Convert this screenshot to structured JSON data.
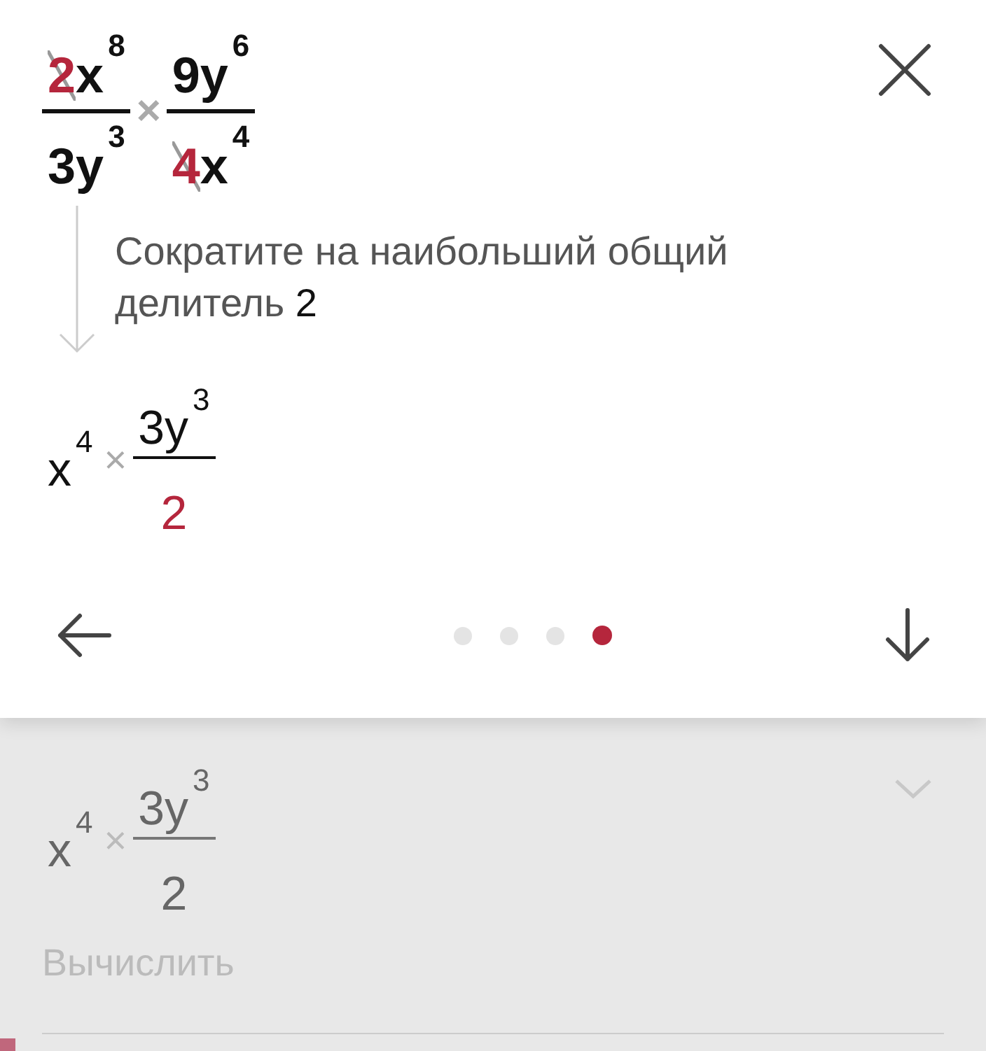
{
  "step_card": {
    "expression": [
      {
        "kind": "fraction",
        "numerator": [
          {
            "base": "2",
            "struck": true,
            "highlight": true
          },
          {
            "base": "x",
            "power": "8",
            "struck": false,
            "highlight": false
          }
        ],
        "denominator": [
          {
            "base": "3",
            "struck": false,
            "highlight": false
          },
          {
            "base": "y",
            "power": "3",
            "struck": false,
            "highlight": false
          }
        ]
      },
      {
        "kind": "times",
        "text": "×"
      },
      {
        "kind": "fraction",
        "numerator": [
          {
            "base": "9",
            "struck": false,
            "highlight": false
          },
          {
            "base": "y",
            "power": "6",
            "struck": false,
            "highlight": false
          }
        ],
        "denominator": [
          {
            "base": "4",
            "struck": true,
            "highlight": true
          },
          {
            "base": "x",
            "power": "4",
            "struck": false,
            "highlight": false
          }
        ]
      }
    ],
    "hint_text": "Сократите на наибольший общий делитель",
    "hint_value": "2",
    "result": [
      {
        "kind": "term",
        "term": {
          "base": "x",
          "power": "4",
          "struck": false,
          "highlight": false
        }
      },
      {
        "kind": "times",
        "text": "×"
      },
      {
        "kind": "fraction",
        "numerator": [
          {
            "base": "3",
            "struck": false,
            "highlight": false
          },
          {
            "base": "y",
            "power": "3",
            "struck": false,
            "highlight": false
          }
        ],
        "denominator": [
          {
            "base": "2",
            "struck": false,
            "highlight": true
          }
        ]
      }
    ],
    "pager": [
      {
        "selected": false
      },
      {
        "selected": false
      },
      {
        "selected": false
      },
      {
        "selected": true
      }
    ]
  },
  "next_step": {
    "expanded": false,
    "expression": [
      {
        "kind": "term",
        "term": {
          "base": "x",
          "power": "4",
          "struck": false,
          "highlight": false
        }
      },
      {
        "kind": "times",
        "text": "×"
      },
      {
        "kind": "fraction",
        "numerator": [
          {
            "base": "3",
            "struck": false,
            "highlight": false
          },
          {
            "base": "y",
            "power": "3",
            "struck": false,
            "highlight": false
          }
        ],
        "denominator": [
          {
            "base": "2",
            "struck": false,
            "highlight": false
          }
        ]
      }
    ],
    "label": "Вычислить"
  }
}
